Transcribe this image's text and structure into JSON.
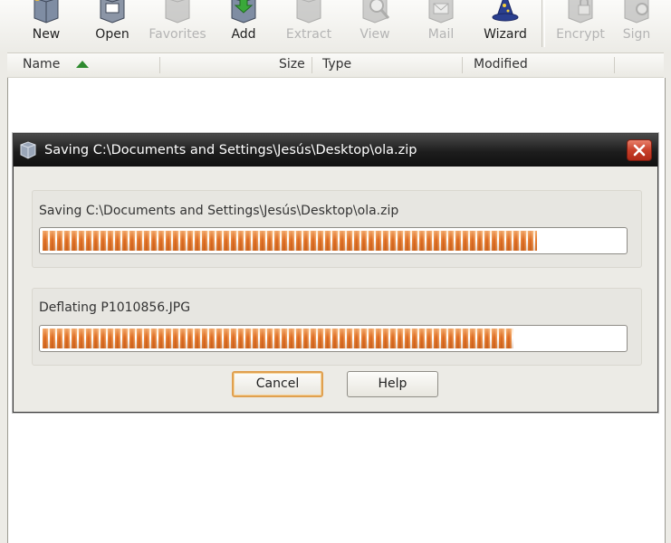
{
  "toolbar": {
    "buttons": [
      {
        "label": "New",
        "icon": "new-archive-icon",
        "enabled": true
      },
      {
        "label": "Open",
        "icon": "open-archive-icon",
        "enabled": true
      },
      {
        "label": "Favorites",
        "icon": "favorites-icon",
        "enabled": false
      },
      {
        "label": "Add",
        "icon": "add-files-icon",
        "enabled": true
      },
      {
        "label": "Extract",
        "icon": "extract-icon",
        "enabled": false
      },
      {
        "label": "View",
        "icon": "view-icon",
        "enabled": false
      },
      {
        "label": "Mail",
        "icon": "mail-icon",
        "enabled": false
      },
      {
        "label": "Wizard",
        "icon": "wizard-icon",
        "enabled": true
      },
      {
        "label": "Encrypt",
        "icon": "encrypt-icon",
        "enabled": false
      },
      {
        "label": "Sign",
        "icon": "sign-icon",
        "enabled": false
      }
    ]
  },
  "file_list": {
    "columns": [
      {
        "label": "Name",
        "sorted": "ascending"
      },
      {
        "label": "Size"
      },
      {
        "label": "Type"
      },
      {
        "label": "Modified"
      }
    ]
  },
  "dialog": {
    "title": "Saving C:\\Documents and Settings\\Jesús\\Desktop\\ola.zip",
    "overall": {
      "label": "Saving C:\\Documents and Settings\\Jesús\\Desktop\\ola.zip",
      "progress": 0.85
    },
    "current_file": {
      "label": "Deflating P1010856.JPG",
      "progress": 0.81
    },
    "cancel_label": "Cancel",
    "help_label": "Help"
  },
  "colors": {
    "progress_fill": "#e87a30",
    "titlebar": "#1d1d1d",
    "close_button": "#c8402a",
    "sort_arrow": "#2e8a2e"
  }
}
